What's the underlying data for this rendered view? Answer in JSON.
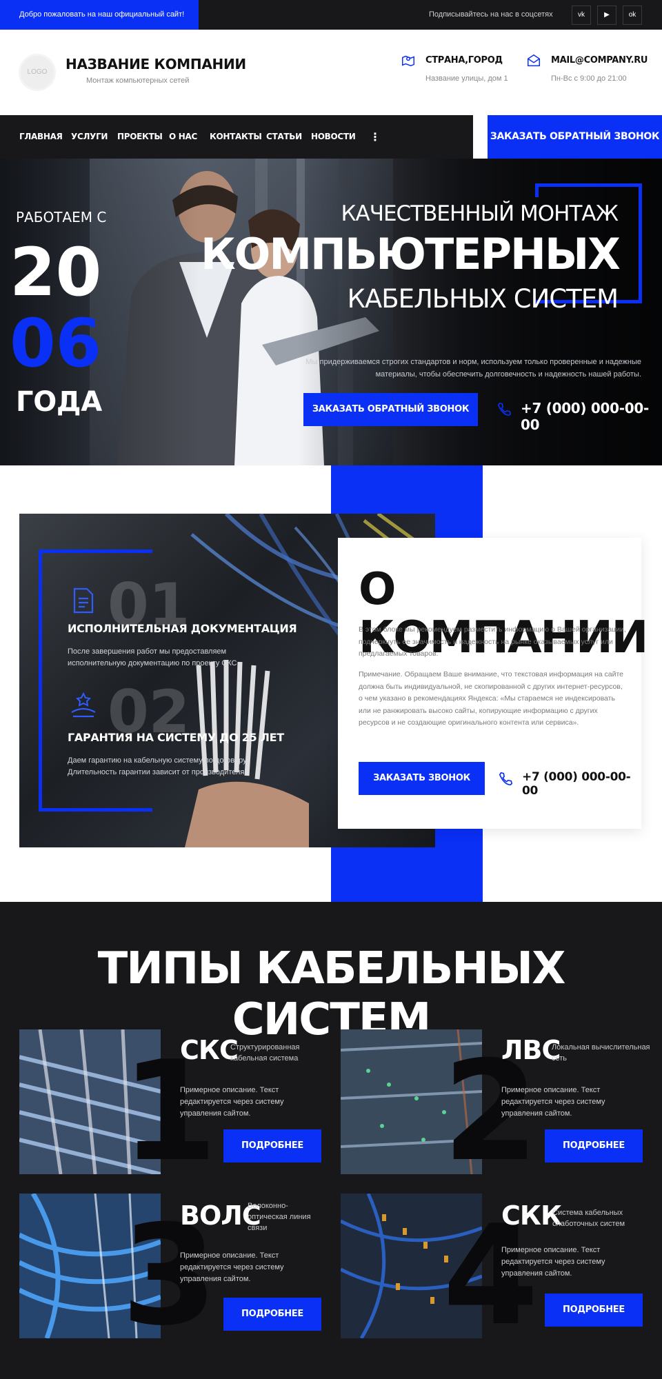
{
  "topbar": {
    "welcome": "Добро пожаловать на наш официальный сайт!",
    "follow": "Подписывайтесь на нас в соцсетях",
    "social": [
      "vk",
      "▶",
      "ok"
    ]
  },
  "header": {
    "logo": "LOGO",
    "company": "НАЗВАНИЕ КОМПАНИИ",
    "company_sub": "Монтаж компьютерных сетей",
    "city": "СТРАНА,ГОРОД",
    "street": "Название улицы, дом 1",
    "email": "MAIL@COMPANY.RU",
    "hours": "Пн-Вс с 9:00 до 21:00"
  },
  "nav": {
    "items": [
      "ГЛАВНАЯ",
      "УСЛУГИ",
      "ПРОЕКТЫ",
      "О НАС",
      "КОНТАКТЫ",
      "СТАТЬИ",
      "НОВОСТИ"
    ],
    "more": "⋮",
    "callback": "ЗАКАЗАТЬ ОБРАТНЫЙ ЗВОНОК"
  },
  "hero": {
    "working_since": "РАБОТАЕМ С",
    "year_top": "20",
    "year_bottom": "06",
    "year_word": "ГОДА",
    "title_line1": "КАЧЕСТВЕННЫЙ МОНТАЖ",
    "title_line2": "КОМПЬЮТЕРНЫХ",
    "title_line3": "КАБЕЛЬНЫХ СИСТЕМ",
    "description": "Мы придерживаемся строгих стандартов и норм, используем только проверенные и надежные материалы, чтобы обеспечить долговечность и надежность нашей работы.",
    "button": "ЗАКАЗАТЬ ОБРАТНЫЙ ЗВОНОК",
    "phone": "+7 (000) 000-00-00"
  },
  "about": {
    "features": [
      {
        "num": "01",
        "title": "ИСПОЛНИТЕЛЬНАЯ ДОКУМЕНТАЦИЯ",
        "text": "После завершения работ мы предоставляем исполнительную документацию по проекту СКС."
      },
      {
        "num": "02",
        "title": "ГАРАНТИЯ НА СИСТЕМУ ДО 25 ЛЕТ",
        "text": "Даем гарантию на кабельную систему по договору. Длительность гарантии зависит от производителя."
      }
    ],
    "title": "О КОМПАНИИ",
    "p1": "В этом блоке мы рекомендуем разместить информацию о Вашей организации, подчеркнуть ее значимость и надежность на рынке оказываемых услуг или предлагаемых товаров.",
    "p2": "Примечание. Обращаем Ваше внимание, что текстовая информация на сайте должна быть индивидуальной, не скопированной с других интернет-ресурсов, о чем указано в рекомендациях Яндекса: «Мы стараемся не индексировать или не ранжировать высоко сайты, копирующие информацию с других ресурсов и не создающие оригинального контента или сервиса».",
    "button": "ЗАКАЗАТЬ ЗВОНОК",
    "phone": "+7 (000) 000-00-00"
  },
  "types": {
    "title": "ТИПЫ КАБЕЛЬНЫХ СИСТЕМ",
    "cards": [
      {
        "num": "1",
        "title": "СКС",
        "subtitle": "Структурированная кабельная система",
        "text": "Примерное описание. Текст редактируется через систему управления сайтом.",
        "button": "ПОДРОБНЕЕ"
      },
      {
        "num": "2",
        "title": "ЛВС",
        "subtitle": "Локальная вычислительная сеть",
        "text": "Примерное описание. Текст редактируется через систему управления сайтом.",
        "button": "ПОДРОБНЕЕ"
      },
      {
        "num": "3",
        "title": "ВОЛС",
        "subtitle": "Волоконно-оптическая линия связи",
        "text": "Примерное описание. Текст редактируется через систему управления сайтом.",
        "button": "ПОДРОБНЕЕ"
      },
      {
        "num": "4",
        "title": "СКК",
        "subtitle": "Система кабельных слаботочных систем",
        "text": "Примерное описание. Текст редактируется через систему управления сайтом.",
        "button": "ПОДРОБНЕЕ"
      }
    ]
  },
  "colors": {
    "accent": "#0a2ff5",
    "dark": "#18181a"
  }
}
